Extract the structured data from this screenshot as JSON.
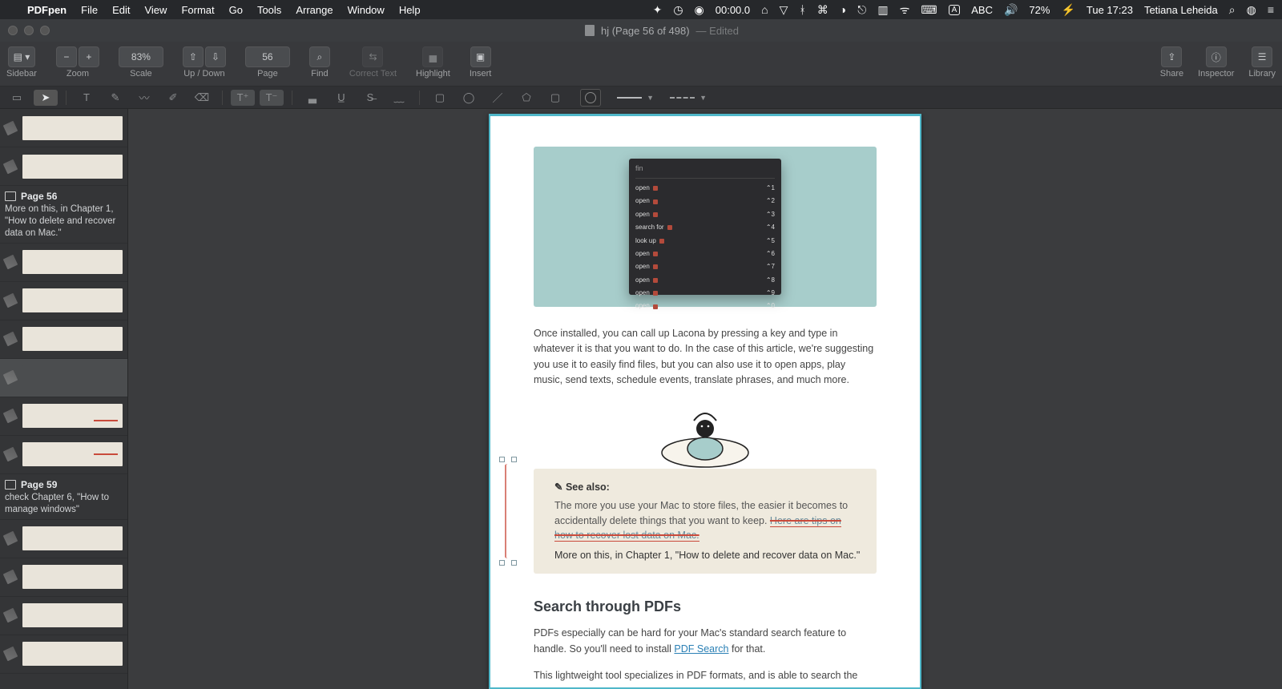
{
  "menubar": {
    "app_name": "PDFpen",
    "menus": [
      "File",
      "Edit",
      "View",
      "Format",
      "Go",
      "Tools",
      "Arrange",
      "Window",
      "Help"
    ],
    "timer": "00:00.0",
    "input_badge": "ABC",
    "battery_pct": "72%",
    "clock": "Tue 17:23",
    "username": "Tetiana Leheida"
  },
  "window": {
    "title": "hj (Page 56 of 498)",
    "edited_suffix": "— Edited"
  },
  "toolbar": {
    "sidebar_label": "Sidebar",
    "zoom_label": "Zoom",
    "scale_label": "Scale",
    "scale_value": "83%",
    "updown_label": "Up / Down",
    "page_label": "Page",
    "page_value": "56",
    "find_label": "Find",
    "correct_label": "Correct Text",
    "highlight_label": "Highlight",
    "insert_label": "Insert",
    "share_label": "Share",
    "inspector_label": "Inspector",
    "library_label": "Library"
  },
  "sidebar": {
    "outline1_title": "Page 56",
    "outline1_body": "More on this, in Chapter 1, \"How to delete and recover data on Mac.\"",
    "outline2_title": "Page 59",
    "outline2_body": "check Chapter 6, \"How to manage windows\""
  },
  "page": {
    "panel_top": "fin",
    "panel_rows": [
      {
        "l": "open",
        "k": "⌃1"
      },
      {
        "l": "open",
        "k": "⌃2"
      },
      {
        "l": "open",
        "k": "⌃3"
      },
      {
        "l": "search for",
        "k": "⌃4"
      },
      {
        "l": "look up",
        "k": "⌃5"
      },
      {
        "l": "open",
        "k": "⌃6"
      },
      {
        "l": "open",
        "k": "⌃7"
      },
      {
        "l": "open",
        "k": "⌃8"
      },
      {
        "l": "open",
        "k": "⌃9"
      },
      {
        "l": "open",
        "k": "⌃0"
      }
    ],
    "para1": "Once installed, you can call up Lacona by pressing a key and type in whatever it is that you want to do. In the case of this article, we're suggesting you use it to easily find files, but you can also use it to open apps, play music, send texts, schedule events, translate phrases, and much more.",
    "note_see": "See also:",
    "note_body1": "The more you use your Mac to store files, the easier it becomes to accidentally delete things that you want to keep. ",
    "note_strike1": "Here are tips on",
    "note_strike2": "how to recover lost data on Mac.",
    "note_added": "More on this, in Chapter 1, \"How to delete and recover data on Mac.\"",
    "h2": "Search through PDFs",
    "para2a": "PDFs especially can be hard for your Mac's standard search feature to handle. So you'll need to install ",
    "para2_link": "PDF Search",
    "para2b": " for that.",
    "para3": "This lightweight tool specializes in PDF formats, and is able to search the"
  }
}
